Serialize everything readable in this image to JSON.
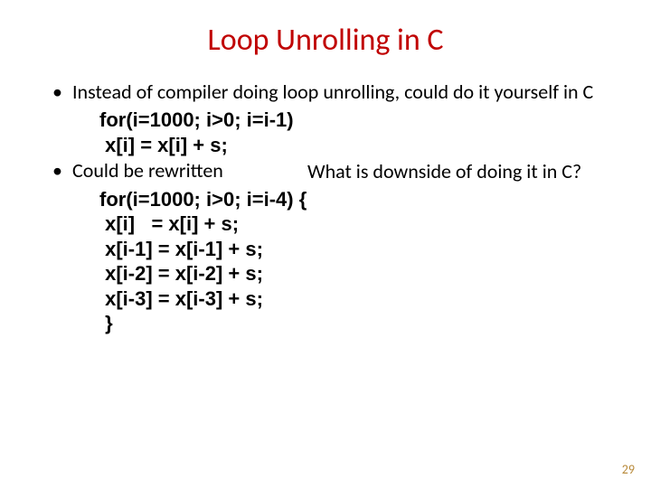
{
  "title": "Loop Unrolling in C",
  "bullets": {
    "b1": "Instead of compiler doing loop unrolling, could do it yourself in C",
    "b2": "Could be rewritten"
  },
  "code1": "for(i=1000; i>0; i=i-1)\n x[i] = x[i] + s;",
  "callout": "What is downside of doing it in C?",
  "code2": "for(i=1000; i>0; i=i-4) {\n x[i]   = x[i] + s;\n x[i-1] = x[i-1] + s;\n x[i-2] = x[i-2] + s;\n x[i-3] = x[i-3] + s;\n }",
  "page": "29"
}
